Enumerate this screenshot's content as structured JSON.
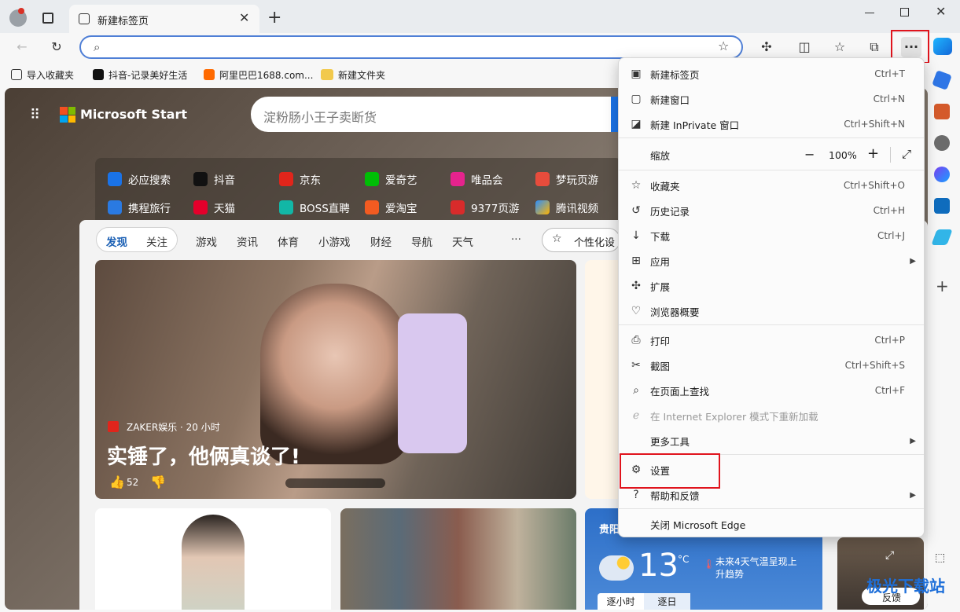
{
  "tab": {
    "title": "新建标签页"
  },
  "address": {
    "placeholder": ""
  },
  "favorites": [
    {
      "label": "导入收藏夹"
    },
    {
      "label": "抖音-记录美好生活"
    },
    {
      "label": "阿里巴巴1688.com..."
    },
    {
      "label": "新建文件夹"
    }
  ],
  "start": {
    "brand": "Microsoft Start",
    "search_placeholder": "淀粉肠小王子卖断货"
  },
  "quick_links": [
    {
      "label": "必应搜索"
    },
    {
      "label": "抖音"
    },
    {
      "label": "京东"
    },
    {
      "label": "爱奇艺"
    },
    {
      "label": "唯品会"
    },
    {
      "label": "梦玩页游"
    },
    {
      "label": "携程旅行"
    },
    {
      "label": "天猫"
    },
    {
      "label": "BOSS直聘"
    },
    {
      "label": "爱淘宝"
    },
    {
      "label": "9377页游"
    },
    {
      "label": "腾讯视频"
    }
  ],
  "feed_tabs": {
    "discover": "发现",
    "follow": "关注",
    "items": [
      "游戏",
      "资讯",
      "体育",
      "小游戏",
      "财经",
      "导航",
      "天气"
    ],
    "more": "···",
    "personalize": "个性化设"
  },
  "hero": {
    "source": "ZAKER娱乐 · 20 小时",
    "headline": "实锤了，他俩真谈了!",
    "likes": "52"
  },
  "weather": {
    "city": "贵阳",
    "temp": "13",
    "unit": "°C",
    "alert": "未来4天气温呈现上升趋势",
    "tab_hourly": "逐小时",
    "tab_daily": "逐日"
  },
  "feedback": "反馈",
  "watermark": "极光下载站",
  "menu": {
    "items": [
      {
        "label": "新建标签页",
        "shortcut": "Ctrl+T"
      },
      {
        "label": "新建窗口",
        "shortcut": "Ctrl+N"
      },
      {
        "label": "新建 InPrivate 窗口",
        "shortcut": "Ctrl+Shift+N"
      },
      {
        "label": "缩放",
        "zoom": "100%"
      },
      {
        "label": "收藏夹",
        "shortcut": "Ctrl+Shift+O"
      },
      {
        "label": "历史记录",
        "shortcut": "Ctrl+H"
      },
      {
        "label": "下载",
        "shortcut": "Ctrl+J"
      },
      {
        "label": "应用"
      },
      {
        "label": "扩展"
      },
      {
        "label": "浏览器概要"
      },
      {
        "label": "打印",
        "shortcut": "Ctrl+P"
      },
      {
        "label": "截图",
        "shortcut": "Ctrl+Shift+S"
      },
      {
        "label": "在页面上查找",
        "shortcut": "Ctrl+F"
      },
      {
        "label": "在 Internet Explorer 模式下重新加载"
      },
      {
        "label": "更多工具"
      },
      {
        "label": "设置"
      },
      {
        "label": "帮助和反馈"
      },
      {
        "label": "关闭 Microsoft Edge"
      }
    ]
  }
}
